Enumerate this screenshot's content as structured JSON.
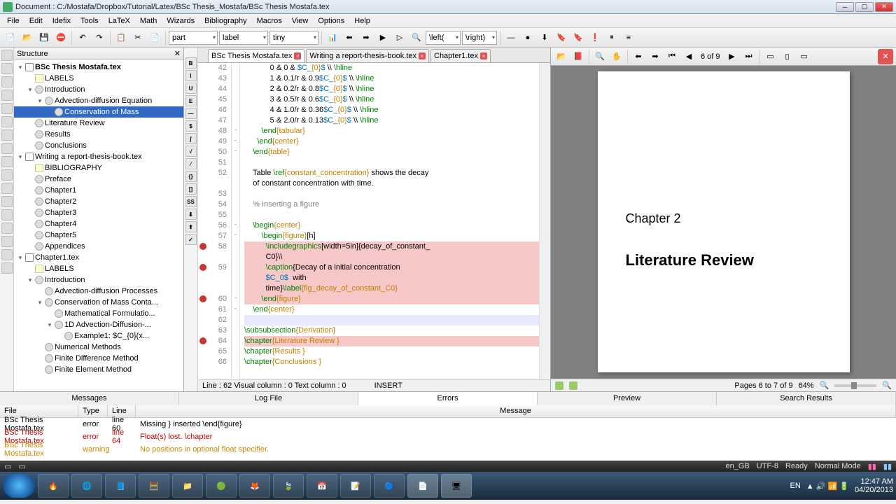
{
  "title": "Document : C:/Mostafa/Dropbox/Tutorial/Latex/BSc Thesis_Mostafa/BSc Thesis Mostafa.tex",
  "menus": [
    "File",
    "Edit",
    "Idefix",
    "Tools",
    "LaTeX",
    "Math",
    "Wizards",
    "Bibliography",
    "Macros",
    "View",
    "Options",
    "Help"
  ],
  "combos": {
    "c1": "part",
    "c2": "label",
    "c3": "tiny",
    "c4": "\\left(",
    "c5": "\\right)"
  },
  "structure_title": "Structure",
  "tree": [
    {
      "d": 0,
      "t": "▾",
      "i": "doc",
      "l": "BSc Thesis Mostafa.tex",
      "b": true
    },
    {
      "d": 1,
      "t": "",
      "i": "lbl",
      "l": "LABELS"
    },
    {
      "d": 1,
      "t": "▾",
      "i": "sec",
      "l": "Introduction"
    },
    {
      "d": 2,
      "t": "▾",
      "i": "sec",
      "l": "Advection-diffusion Equation"
    },
    {
      "d": 3,
      "t": "",
      "i": "sec",
      "l": "Conservation of Mass",
      "sel": true
    },
    {
      "d": 1,
      "t": "",
      "i": "sec",
      "l": "Literature Review"
    },
    {
      "d": 1,
      "t": "",
      "i": "sec",
      "l": "Results"
    },
    {
      "d": 1,
      "t": "",
      "i": "sec",
      "l": "Conclusions"
    },
    {
      "d": 0,
      "t": "▾",
      "i": "doc",
      "l": "Writing a report-thesis-book.tex"
    },
    {
      "d": 1,
      "t": "",
      "i": "lbl",
      "l": "BIBLIOGRAPHY"
    },
    {
      "d": 1,
      "t": "",
      "i": "sec",
      "l": "Preface"
    },
    {
      "d": 1,
      "t": "",
      "i": "sec",
      "l": "Chapter1"
    },
    {
      "d": 1,
      "t": "",
      "i": "sec",
      "l": "Chapter2"
    },
    {
      "d": 1,
      "t": "",
      "i": "sec",
      "l": "Chapter3"
    },
    {
      "d": 1,
      "t": "",
      "i": "sec",
      "l": "Chapter4"
    },
    {
      "d": 1,
      "t": "",
      "i": "sec",
      "l": "Chapter5"
    },
    {
      "d": 1,
      "t": "",
      "i": "sec",
      "l": "Appendices"
    },
    {
      "d": 0,
      "t": "▾",
      "i": "doc",
      "l": "Chapter1.tex"
    },
    {
      "d": 1,
      "t": "",
      "i": "lbl",
      "l": "LABELS"
    },
    {
      "d": 1,
      "t": "▾",
      "i": "sec",
      "l": "Introduction"
    },
    {
      "d": 2,
      "t": "",
      "i": "sec",
      "l": "Advection-diffusion Processes"
    },
    {
      "d": 2,
      "t": "▾",
      "i": "sec",
      "l": "Conservation of Mass Conta..."
    },
    {
      "d": 3,
      "t": "",
      "i": "sec",
      "l": "Mathematical Formulatio..."
    },
    {
      "d": 3,
      "t": "▾",
      "i": "sec",
      "l": "1D Advection-Diffusion-..."
    },
    {
      "d": 4,
      "t": "",
      "i": "sec",
      "l": "Example1: $C_{0}(x..."
    },
    {
      "d": 2,
      "t": "",
      "i": "sec",
      "l": "Numerical Methods"
    },
    {
      "d": 2,
      "t": "",
      "i": "sec",
      "l": "Finite Difference Method"
    },
    {
      "d": 2,
      "t": "",
      "i": "sec",
      "l": "Finite Element Method"
    }
  ],
  "tabs": [
    {
      "l": "BSc Thesis Mostafa.tex",
      "act": true
    },
    {
      "l": "Writing a report-thesis-book.tex"
    },
    {
      "l": "Chapter1.tex"
    }
  ],
  "lines": [
    {
      "n": 42,
      "raw": "            0 & 0 & $C_{0}$ \\\\ \\hline"
    },
    {
      "n": 43,
      "raw": "            1 & 0.1/r & 0.9$C_{0}$ \\\\ \\hline"
    },
    {
      "n": 44,
      "raw": "            2 & 0.2/r & 0.8$C_{0}$ \\\\ \\hline"
    },
    {
      "n": 45,
      "raw": "            3 & 0.5/r & 0.6$C_{0}$ \\\\ \\hline"
    },
    {
      "n": 46,
      "raw": "            4 & 1.0/r & 0.36$C_{0}$ \\\\ \\hline"
    },
    {
      "n": 47,
      "raw": "            5 & 2.0/r & 0.13$C_{0}$ \\\\ \\hline"
    },
    {
      "n": 48,
      "raw": "        \\end{tabular}",
      "f": "-"
    },
    {
      "n": 49,
      "raw": "      \\end{center}",
      "f": "-"
    },
    {
      "n": 50,
      "raw": "    \\end{table}",
      "f": "-"
    },
    {
      "n": 51,
      "raw": ""
    },
    {
      "n": 52,
      "raw": "    Table \\ref{constant_concentration} shows the decay"
    },
    {
      "n": "",
      "raw": "    of constant concentration with time."
    },
    {
      "n": 53,
      "raw": ""
    },
    {
      "n": 54,
      "raw": "    % Inserting a figure",
      "cm": true
    },
    {
      "n": 55,
      "raw": ""
    },
    {
      "n": 56,
      "raw": "    \\begin{center}",
      "f": "-"
    },
    {
      "n": 57,
      "raw": "        \\begin{figure}[h]",
      "f": "-"
    },
    {
      "n": 58,
      "raw": "          \\includegraphics[width=5in]{decay_of_constant_",
      "hl": true,
      "err": true
    },
    {
      "n": "",
      "raw": "          C0}\\\\",
      "hl": true
    },
    {
      "n": 59,
      "raw": "          \\caption{Decay of a initial concentration",
      "hl": true,
      "err": true
    },
    {
      "n": "",
      "raw": "          $C_0$  with",
      "hl": true
    },
    {
      "n": "",
      "raw": "          time}\\label{fig_decay_of_constant_C0}",
      "hl": true
    },
    {
      "n": 60,
      "raw": "        \\end{figure}",
      "hl": true,
      "err": true,
      "f": "-"
    },
    {
      "n": 61,
      "raw": "    \\end{center}",
      "f": "-"
    },
    {
      "n": 62,
      "raw": "",
      "cur": true
    },
    {
      "n": 63,
      "raw": "\\subsubsection{Derivation}"
    },
    {
      "n": 64,
      "raw": "\\chapter{Literature Review }",
      "hl": true,
      "err": true
    },
    {
      "n": 65,
      "raw": "\\chapter{Results }"
    },
    {
      "n": 66,
      "raw": "\\chapter{Conclusions }"
    }
  ],
  "edstatus": {
    "pos": "Line : 62 Visual column : 0 Text column : 0",
    "mode": "INSERT"
  },
  "pdf": {
    "chnum": "Chapter 2",
    "chtitle": "Literature Review",
    "nav": "6 of 9",
    "pages": "Pages 6 to 7 of 9",
    "zoom": "64%"
  },
  "bottabs": [
    "Messages",
    "Log File",
    "Errors",
    "Preview",
    "Search Results"
  ],
  "errhead": {
    "file": "File",
    "type": "Type",
    "line": "Line",
    "msg": "Message"
  },
  "errors": [
    {
      "f": "BSc Thesis Mostafa.tex",
      "t": "error",
      "ln": "line 60",
      "m": "Missing } inserted \\end{figure}",
      "c": "e"
    },
    {
      "f": "BSc Thesis Mostafa.tex",
      "t": "error",
      "ln": "line 64",
      "m": "Float(s) lost. \\chapter",
      "c": "e2"
    },
    {
      "f": "BSc Thesis Mostafa.tex",
      "t": "warning",
      "ln": "",
      "m": "No positions in optional float specifier.",
      "c": "w"
    }
  ],
  "status": {
    "lang": "en_GB",
    "enc": "UTF-8",
    "ready": "Ready",
    "mode": "Normal Mode"
  },
  "tray": {
    "lang": "EN",
    "time": "12:47 AM",
    "date": "04/20/2013"
  }
}
